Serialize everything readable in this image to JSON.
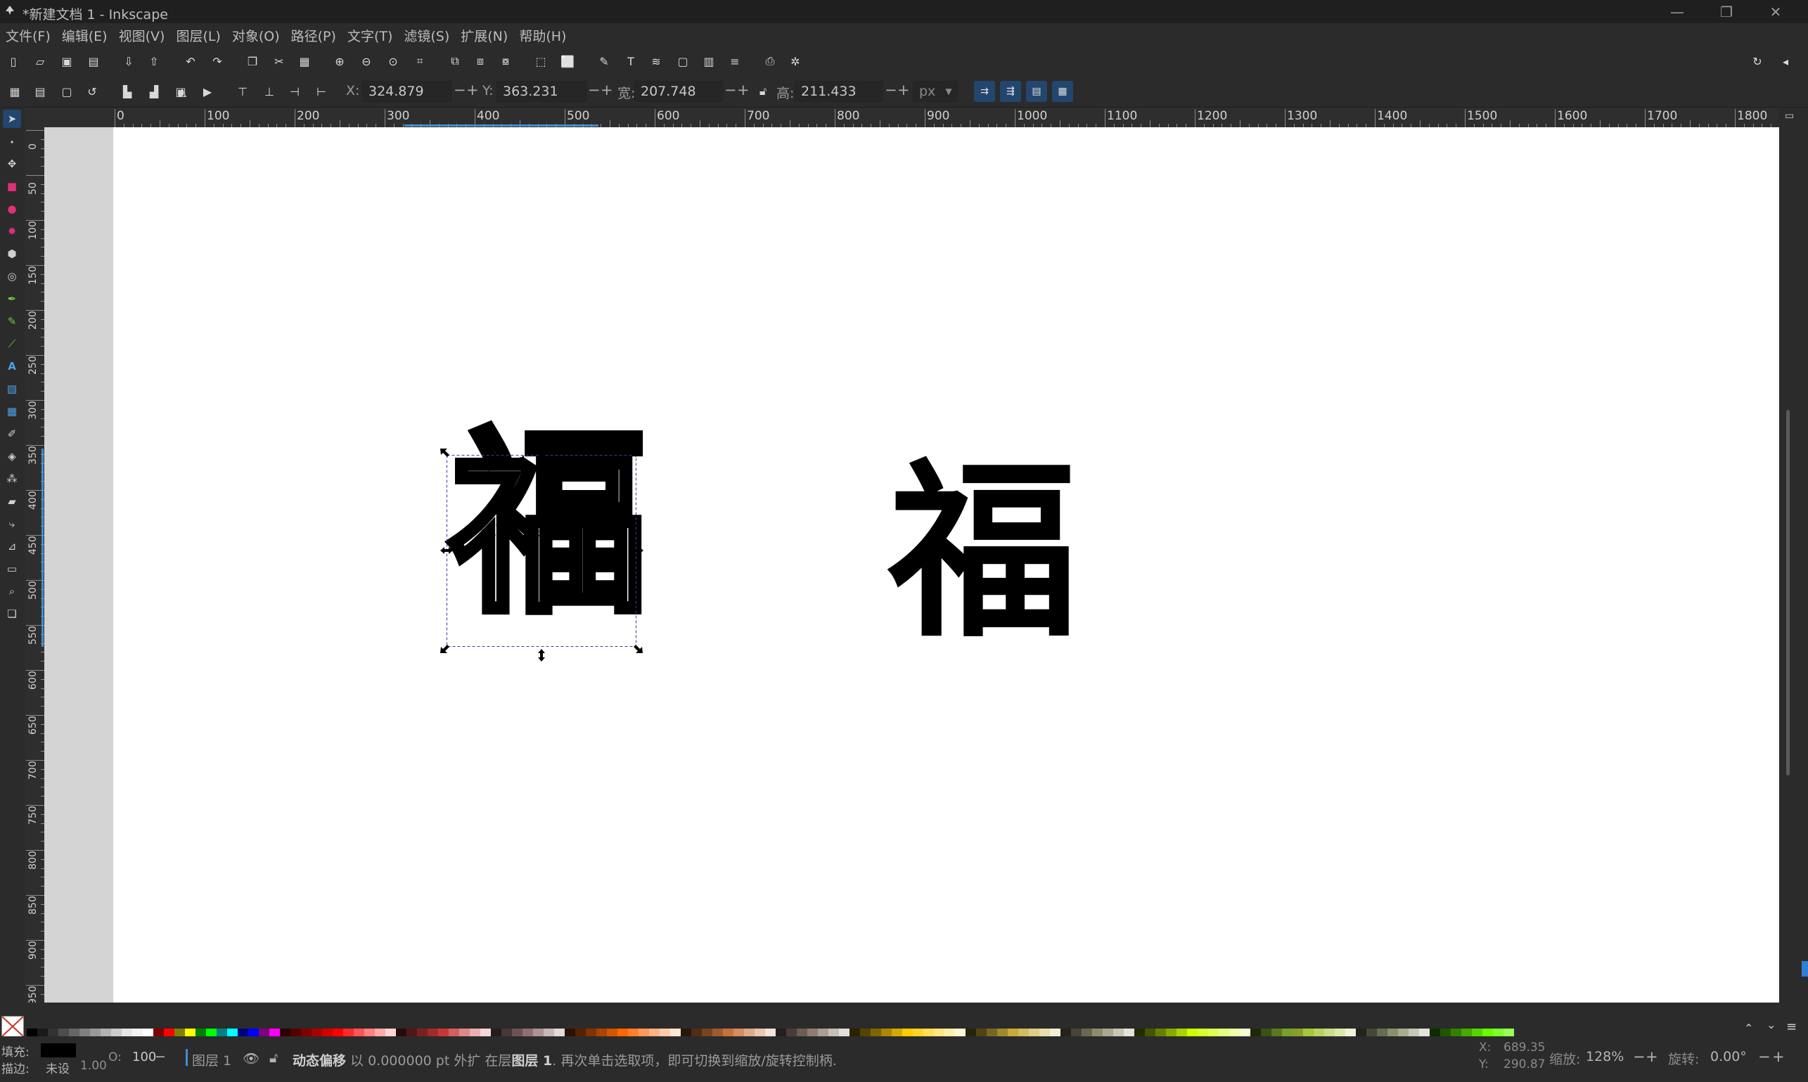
{
  "window": {
    "title": "*新建文档 1 - Inkscape",
    "controls": {
      "minimize": "—",
      "maximize": "❐",
      "close": "✕"
    }
  },
  "menu": [
    "文件(F)",
    "编辑(E)",
    "视图(V)",
    "图层(L)",
    "对象(O)",
    "路径(P)",
    "文字(T)",
    "滤镜(S)",
    "扩展(N)",
    "帮助(H)"
  ],
  "toolcontrols": {
    "x_label": "X:",
    "x_value": "324.879",
    "y_label": "Y:",
    "y_value": "363.231",
    "w_label": "宽:",
    "w_value": "207.748",
    "h_label": "高:",
    "h_value": "211.433",
    "unit": "px",
    "minus": "−",
    "plus": "+"
  },
  "ruler": {
    "h_labels": [
      "0",
      "100",
      "200",
      "300",
      "400",
      "500",
      "600",
      "700",
      "800",
      "900",
      "1000",
      "1100",
      "1200",
      "1300",
      "1400",
      "1500",
      "1600",
      "1700",
      "1800"
    ],
    "v_labels": [
      "0",
      "50",
      "100",
      "150",
      "200",
      "250",
      "300",
      "350",
      "400",
      "450",
      "500",
      "550",
      "600",
      "650",
      "700",
      "750",
      "800",
      "850",
      "900",
      "950"
    ]
  },
  "canvas": {
    "glyph_outline": "福",
    "glyph_solid": "福"
  },
  "statusbar": {
    "fill_label": "填充:",
    "stroke_label": "描边:",
    "stroke_value": "未设",
    "stroke_width": "1.00",
    "opacity_label": "O:",
    "opacity_value": "100",
    "layer_name": "图层 1",
    "message_bold": "动态偏移",
    "message": " 以 0.000000 pt 外扩 在层",
    "message_layer": "图层 1",
    "message_tail": ". 再次单击选取项，即可切换到缩放/旋转控制柄.",
    "cursor_x_label": "X:",
    "cursor_x": "689.35",
    "cursor_y_label": "Y:",
    "cursor_y": "290.87",
    "zoom_label": "缩放:",
    "zoom_value": "128%",
    "rotate_label": "旋转:",
    "rotate_value": "0.00°"
  },
  "colors": {
    "fill": "#000000",
    "selection_dash": "#3a3ab0",
    "accent": "#23466e"
  }
}
